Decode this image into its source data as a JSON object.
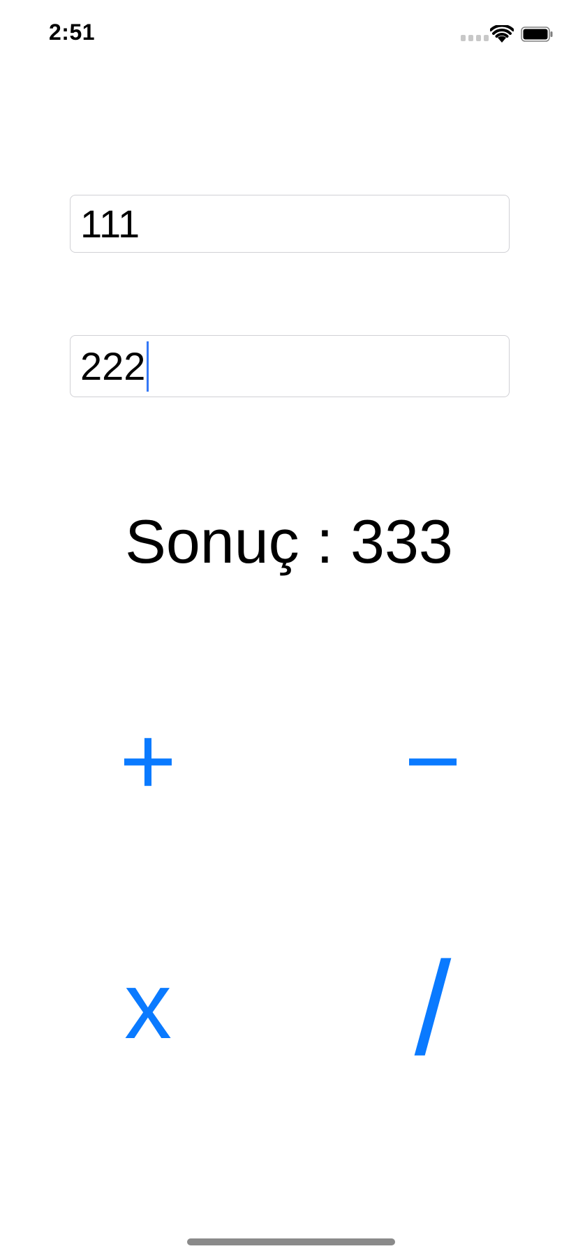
{
  "status_bar": {
    "time": "2:51",
    "icons": [
      "cellular-signal-icon",
      "wifi-icon",
      "battery-icon"
    ]
  },
  "fields": {
    "first_value": "111",
    "second_value": "222"
  },
  "result": {
    "text": "Sonuç : 333"
  },
  "buttons": {
    "add_label": "+",
    "subtract_label": "−",
    "multiply_label": "x",
    "divide_label": "/"
  },
  "colors": {
    "accent": "#0a7aff",
    "cursor": "#3478f6",
    "field_border": "#d0d0d5"
  }
}
